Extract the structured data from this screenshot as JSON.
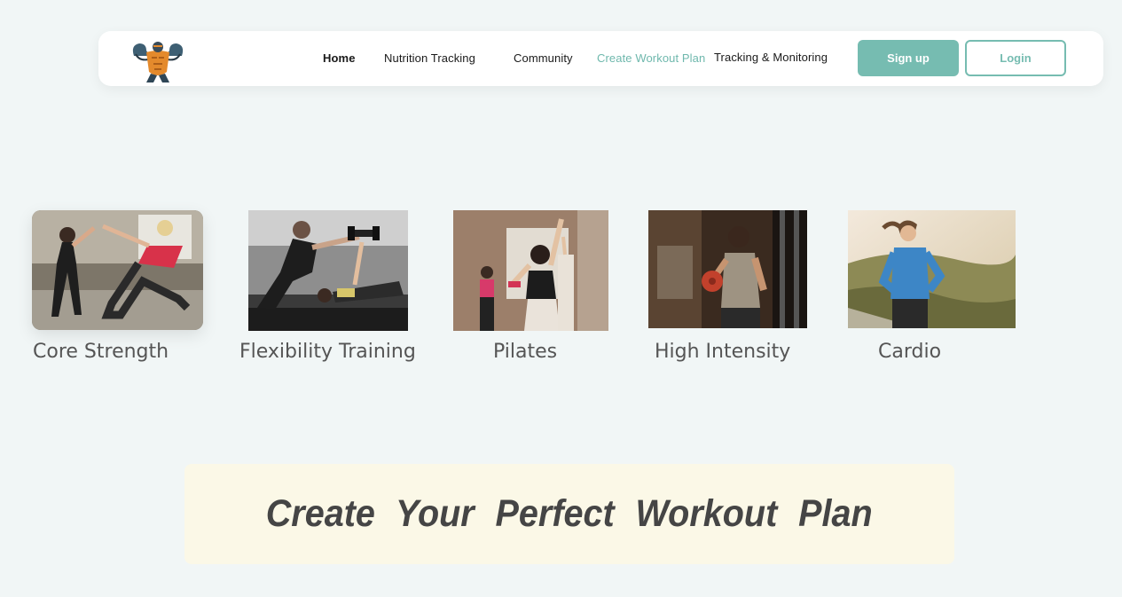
{
  "brand": {
    "logo_icon": "bodybuilder-mascot-icon"
  },
  "nav": {
    "links": [
      {
        "label": "Home"
      },
      {
        "label": "Nutrition Tracking"
      },
      {
        "label": "Community"
      },
      {
        "label": "Create Workout Plan"
      },
      {
        "label": "Tracking & Monitoring"
      }
    ],
    "active": "Create Workout Plan",
    "signup_label": "Sign up",
    "login_label": "Login"
  },
  "categories": [
    {
      "label": "Core Strength",
      "image": "core-strength-photo"
    },
    {
      "label": "Flexibility Training",
      "image": "flexibility-training-photo"
    },
    {
      "label": "Pilates",
      "image": "pilates-photo"
    },
    {
      "label": "High Intensity",
      "image": "high-intensity-photo"
    },
    {
      "label": "Cardio",
      "image": "cardio-photo"
    }
  ],
  "banner": {
    "title": "Create Your Perfect Workout Plan"
  },
  "colors": {
    "accent": "#76bcb1",
    "page_background": "#f1f6f6",
    "banner_background": "#fbf8e7",
    "text_dark": "#454545"
  }
}
